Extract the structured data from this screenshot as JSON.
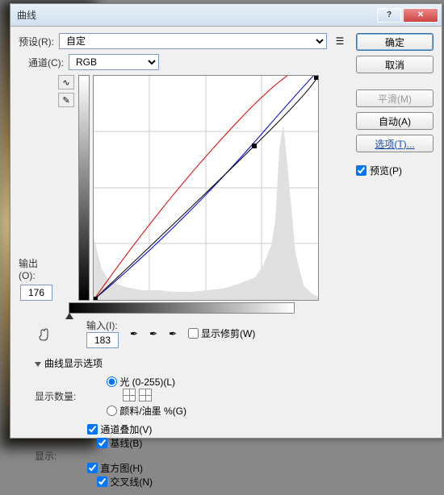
{
  "title": "曲线",
  "preset": {
    "label": "预设(R):",
    "value": "自定"
  },
  "channel": {
    "label": "通道(C):",
    "value": "RGB"
  },
  "output": {
    "label": "输出(O):",
    "value": "176"
  },
  "input": {
    "label": "输入(I):",
    "value": "183"
  },
  "show_clipping": "显示修剪(W)",
  "curve_opts": "曲线显示选项",
  "display_amount": {
    "label": "显示数量:",
    "light": "光 (0-255)(L)",
    "ink": "颜料/油墨 %(G)"
  },
  "show": {
    "label": "显示:",
    "overlay": "通道叠加(V)",
    "baseline": "基线(B)",
    "histogram": "直方图(H)",
    "intersection": "交叉线(N)"
  },
  "buttons": {
    "ok": "确定",
    "cancel": "取消",
    "smooth": "平滑(M)",
    "auto": "自动(A)",
    "options": "选项(T)..."
  },
  "preview": "预览(P)",
  "chart_data": {
    "type": "curve",
    "xrange": [
      0,
      255
    ],
    "yrange": [
      0,
      255
    ],
    "point": {
      "input": 183,
      "output": 176
    },
    "curves": {
      "red": [
        [
          0,
          0
        ],
        [
          90,
          110
        ],
        [
          180,
          205
        ],
        [
          255,
          255
        ]
      ],
      "blue": [
        [
          0,
          0
        ],
        [
          100,
          88
        ],
        [
          200,
          190
        ],
        [
          255,
          255
        ]
      ],
      "black": [
        [
          0,
          0
        ],
        [
          120,
          115
        ],
        [
          183,
          176
        ],
        [
          255,
          255
        ]
      ]
    }
  }
}
